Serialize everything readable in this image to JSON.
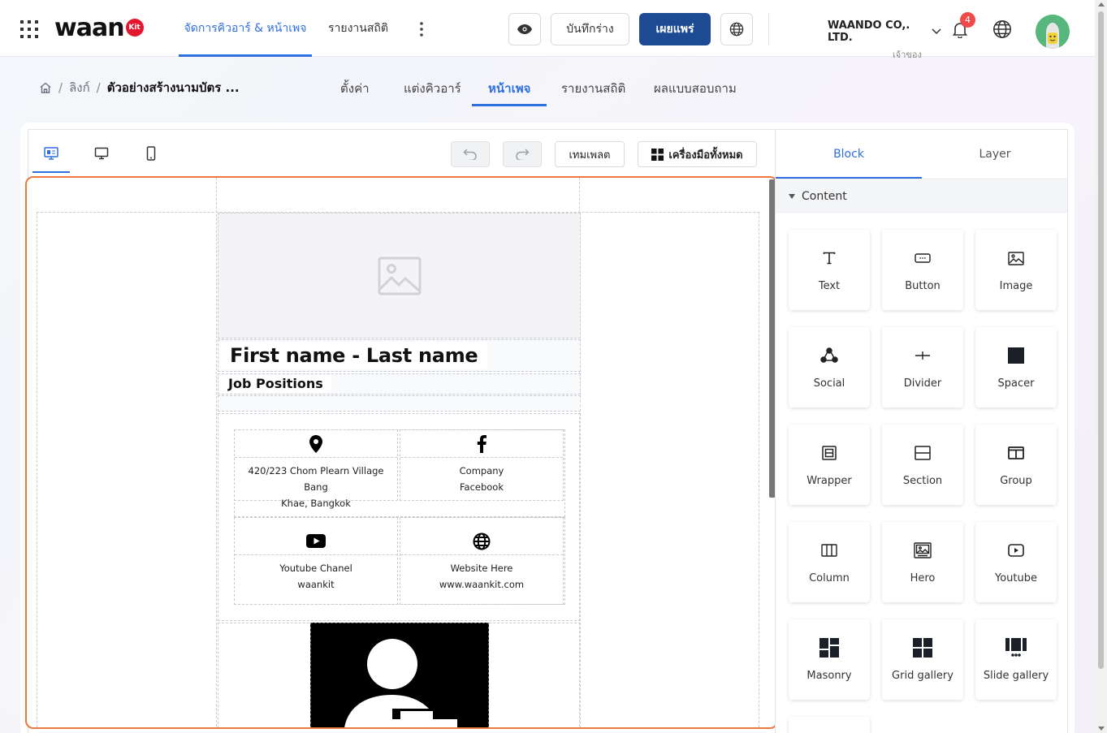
{
  "app": {
    "logo_text": "waan",
    "logo_badge": "Kit",
    "nav_tabs": [
      {
        "label": "จัดการคิวอาร์ & หน้าเพจ",
        "active": true
      },
      {
        "label": "รายงานสถิติ",
        "active": false
      }
    ],
    "draft_label": "บันทึกร่าง",
    "publish_label": "เผยแพร่",
    "company_name": "WAANDO CO,. LTD.",
    "company_role": "เจ้าของ",
    "notification_count": "4"
  },
  "breadcrumb": {
    "link": "ลิงก์",
    "separator": "/",
    "current": "ตัวอย่างสร้างนามบัตร ..."
  },
  "sub_tabs": [
    {
      "label": "ตั้งค่า",
      "active": false
    },
    {
      "label": "แต่งคิวอาร์",
      "active": false
    },
    {
      "label": "หน้าเพจ",
      "active": true
    },
    {
      "label": "รายงานสถิติ",
      "active": false
    },
    {
      "label": "ผลแบบสอบถาม",
      "active": false
    }
  ],
  "toolbar": {
    "template_label": "เทมเพลต",
    "all_tools_label": "เครื่องมือทั้งหมด"
  },
  "canvas": {
    "name": "First name - Last name",
    "job": "Job Positions",
    "cells": [
      {
        "icon": "location-pin-icon",
        "line1": "420/223 Chom Plearn Village Bang",
        "line2": "Khae, Bangkok"
      },
      {
        "icon": "facebook-icon",
        "line1": "Company",
        "line2": "Facebook"
      },
      {
        "icon": "youtube-icon",
        "line1": "Youtube Chanel",
        "line2": "waankit"
      },
      {
        "icon": "globe-icon",
        "line1": "Website Here",
        "line2": "www.waankit.com"
      }
    ]
  },
  "panel": {
    "tabs": [
      {
        "label": "Block",
        "active": true
      },
      {
        "label": "Layer",
        "active": false
      }
    ],
    "section_title": "Content",
    "blocks": [
      {
        "label": "Text",
        "icon": "text-icon"
      },
      {
        "label": "Button",
        "icon": "button-icon"
      },
      {
        "label": "Image",
        "icon": "image-icon"
      },
      {
        "label": "Social",
        "icon": "social-icon"
      },
      {
        "label": "Divider",
        "icon": "divider-icon"
      },
      {
        "label": "Spacer",
        "icon": "spacer-icon"
      },
      {
        "label": "Wrapper",
        "icon": "wrapper-icon"
      },
      {
        "label": "Section",
        "icon": "section-icon"
      },
      {
        "label": "Group",
        "icon": "group-icon"
      },
      {
        "label": "Column",
        "icon": "column-icon"
      },
      {
        "label": "Hero",
        "icon": "hero-icon"
      },
      {
        "label": "Youtube",
        "icon": "youtube-icon"
      },
      {
        "label": "Masonry",
        "icon": "masonry-icon"
      },
      {
        "label": "Grid gallery",
        "icon": "grid-gallery-icon"
      },
      {
        "label": "Slide gallery",
        "icon": "slide-gallery-icon"
      }
    ]
  },
  "colors": {
    "accent": "#2f6fde",
    "publish": "#1c4a93",
    "canvas_outline": "#ea7a42",
    "badge": "#e3152f",
    "notification": "#f04a4a"
  }
}
